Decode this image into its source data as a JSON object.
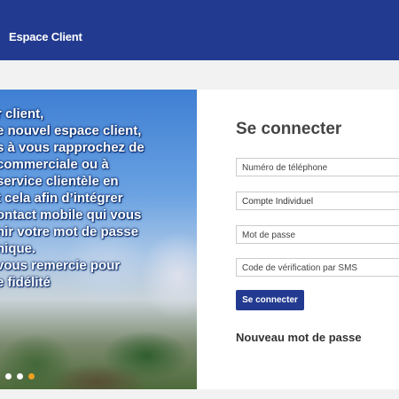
{
  "header": {
    "brand": "Espace Client",
    "color": "#223a8f"
  },
  "hero": {
    "lines": [
      "r client,",
      "e nouvel espace client,",
      "s à vous rapprochez de",
      "commerciale ou à",
      "service clientèle en",
      "t cela afin d’intégrer",
      "ontact mobile qui vous",
      "nir votre mot de passe",
      "nique.",
      "vous remercie pour",
      "e fidélité"
    ],
    "carousel_dots": [
      "#ffffff",
      "#ffffff",
      "#f0a020"
    ]
  },
  "login": {
    "title": "Se connecter",
    "fields": {
      "phone_placeholder": "Numéro de téléphone",
      "account_type_value": "Compte Individuel",
      "password_placeholder": "Mot de passe",
      "sms_code_placeholder": "Code de vérification par SMS"
    },
    "submit_label": "Se connecter",
    "new_password_label": "Nouveau mot de passe"
  }
}
